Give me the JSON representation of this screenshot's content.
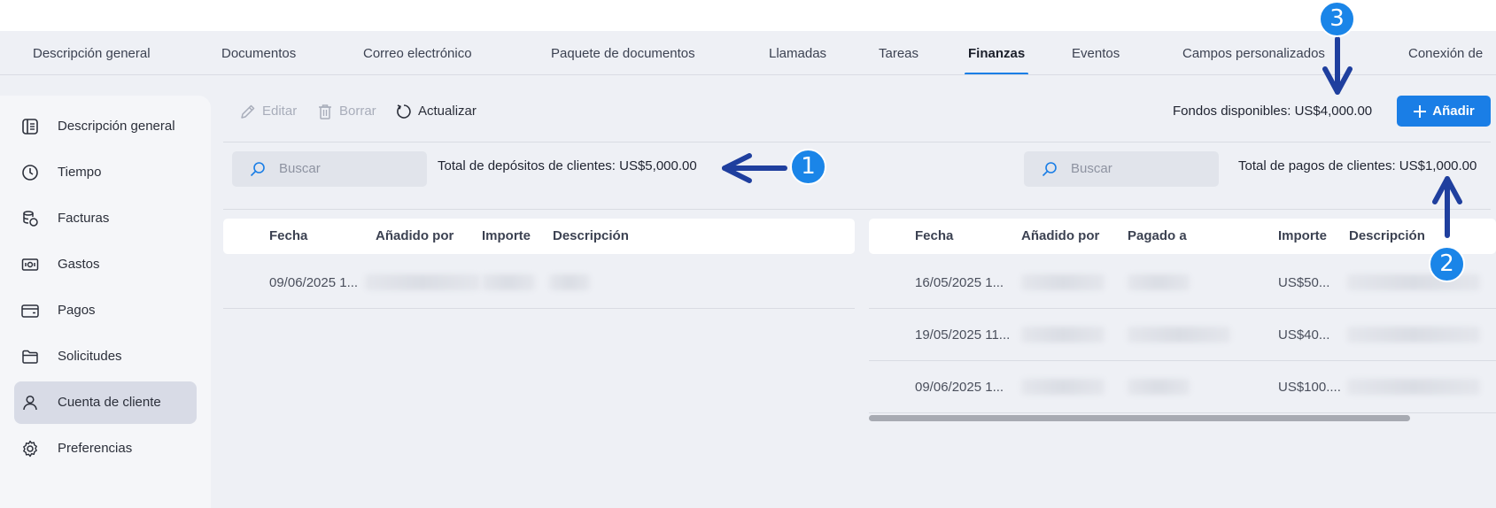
{
  "tabs": [
    {
      "label": "Descripción general"
    },
    {
      "label": "Documentos"
    },
    {
      "label": "Correo electrónico"
    },
    {
      "label": "Paquete de documentos"
    },
    {
      "label": "Llamadas"
    },
    {
      "label": "Tareas"
    },
    {
      "label": "Finanzas",
      "active": true
    },
    {
      "label": "Eventos"
    },
    {
      "label": "Campos personalizados"
    },
    {
      "label": "Conexión de"
    }
  ],
  "sidebar": {
    "items": [
      {
        "label": "Descripción general",
        "icon": "overview-icon"
      },
      {
        "label": "Tiempo",
        "icon": "clock-icon"
      },
      {
        "label": "Facturas",
        "icon": "invoice-icon"
      },
      {
        "label": "Gastos",
        "icon": "expense-icon"
      },
      {
        "label": "Pagos",
        "icon": "wallet-icon"
      },
      {
        "label": "Solicitudes",
        "icon": "folder-icon"
      },
      {
        "label": "Cuenta de cliente",
        "icon": "user-icon",
        "active": true
      },
      {
        "label": "Preferencias",
        "icon": "gear-icon"
      }
    ]
  },
  "toolbar": {
    "edit_label": "Editar",
    "delete_label": "Borrar",
    "refresh_label": "Actualizar",
    "funds_label": "Fondos disponibles: US$4,000.00",
    "add_label": "Añadir"
  },
  "deposits": {
    "search_placeholder": "Buscar",
    "total_label": "Total de depósitos de clientes: US$5,000.00",
    "columns": [
      "Fecha",
      "Añadido por",
      "Importe",
      "Descripción"
    ],
    "rows": [
      {
        "date": "09/06/2025 1..."
      }
    ]
  },
  "payments": {
    "search_placeholder": "Buscar",
    "total_label": "Total de pagos de clientes: US$1,000.00",
    "columns": [
      "Fecha",
      "Añadido por",
      "Pagado a",
      "Importe",
      "Descripción"
    ],
    "rows": [
      {
        "date": "16/05/2025 1...",
        "amount": "US$50..."
      },
      {
        "date": "19/05/2025 11...",
        "amount": "US$40..."
      },
      {
        "date": "09/06/2025 1...",
        "amount": "US$100...."
      }
    ]
  },
  "callouts": [
    "1",
    "2",
    "3"
  ],
  "colors": {
    "accent": "#1a7ee6",
    "callout": "#1a85e8",
    "arrow": "#1f3f9e"
  }
}
